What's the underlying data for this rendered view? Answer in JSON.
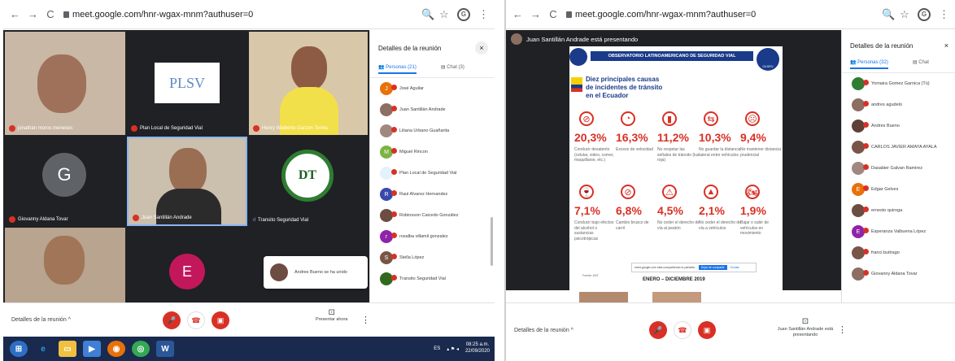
{
  "left": {
    "url": "meet.google.com/hnr-wgax-mnm?authuser=0",
    "panel_title": "Detalles de la reunión",
    "tab_people": "Personas (21)",
    "tab_chat": "Chat (3)",
    "participants": [
      {
        "initial": "J",
        "name": "José Aguilar",
        "color": "#e8710a"
      },
      {
        "initial": "",
        "name": "Juan Santillán Andrade",
        "color": "#8d6e63"
      },
      {
        "initial": "",
        "name": "Liliana Urbano Guañarita",
        "color": "#a1887f"
      },
      {
        "initial": "M",
        "name": "Miguel Rincon",
        "color": "#7cb342"
      },
      {
        "initial": "",
        "name": "Plan Local de Seguridad Vial",
        "color": "#e3f2fd"
      },
      {
        "initial": "R",
        "name": "Raul Alvarez Hernandez",
        "color": "#3949ab"
      },
      {
        "initial": "",
        "name": "Robinsson Caicedo González",
        "color": "#6d4c41"
      },
      {
        "initial": "r",
        "name": "rosalba villamil gonzalez",
        "color": "#8e24aa"
      },
      {
        "initial": "S",
        "name": "Stella López",
        "color": "#795548"
      },
      {
        "initial": "",
        "name": "Transito Seguridad Vial",
        "color": "#33691e"
      }
    ],
    "tiles": [
      {
        "name": "jonathan moros meneses"
      },
      {
        "name": "Plan Local de Seguridad Vial",
        "logo": "PLSV"
      },
      {
        "name": "Henry Walberto Garzon Torres"
      },
      {
        "name": "Giovanny Aldana Tovar",
        "initial": "G"
      },
      {
        "name": "Juan Santillán Andrade"
      },
      {
        "name": "Transito Seguridad Vial",
        "logo": "DT"
      },
      {
        "initial": "E"
      }
    ],
    "toast": "Andres Bueno se ha unido",
    "meeting_details": "Detalles de la reunión",
    "present_now": "Presentar ahora",
    "time": "08:25 a.m.",
    "date": "22/09/2020",
    "lang": "ES"
  },
  "right": {
    "url": "meet.google.com/hnr-wgax-mnm?authuser=0",
    "presenting": "Juan Santillán Andrade está presentando",
    "panel_title": "Detalles de la reunión",
    "tab_people": "Personas (32)",
    "tab_chat": "Chat",
    "participants": [
      {
        "name": "Yomaira Gomez Garnica (Tú)",
        "color": "#2e7d32"
      },
      {
        "name": "andres agudelo",
        "color": "#8d6e63"
      },
      {
        "name": "Andres Bueno",
        "color": "#5d4037"
      },
      {
        "name": "CARLOS JAVIER AMAYA AYALA",
        "color": "#795548"
      },
      {
        "name": "Dasabier Galvan Ramirez",
        "color": "#a1887f"
      },
      {
        "name": "Edgar Gelves",
        "color": "#e8710a",
        "initial": "E"
      },
      {
        "name": "ernesto quiroga",
        "color": "#6d4c41"
      },
      {
        "name": "Esperanza Valbuena López",
        "color": "#8e24aa",
        "initial": "E"
      },
      {
        "name": "franci.buitrago",
        "color": "#795548"
      },
      {
        "name": "Giovanny Aldana Tovar",
        "color": "#8d6e63"
      }
    ],
    "slide": {
      "org": "OBSERVATORIO LATINOAMERICANO DE SEGURIDAD VIAL",
      "logo": "OLSEV",
      "title": "Diez principales causas de incidentes de tránsito en el Ecuador",
      "row1": [
        {
          "pct": "20,3%",
          "desc": "Conducir desatento (celular, video, comer, maquillarse, etc.)",
          "icon": "⊘"
        },
        {
          "pct": "16,3%",
          "desc": "Exceso de velocidad",
          "icon": "◔"
        },
        {
          "pct": "11,2%",
          "desc": "No respetar las señales de tránsito (luz roja)",
          "icon": "▮"
        },
        {
          "pct": "10,3%",
          "desc": "No guardar la distancia lateral entre vehículos",
          "icon": "⇆"
        },
        {
          "pct": "9,4%",
          "desc": "No mantener distancia prudencial",
          "icon": "☹"
        }
      ],
      "row2": [
        {
          "pct": "7,1%",
          "desc": "Conducir bajo efectos del alcohol o sustancias psicotrópicas",
          "icon": "🍷"
        },
        {
          "pct": "6,8%",
          "desc": "Cambio brusco de carril",
          "icon": "⊘"
        },
        {
          "pct": "4,5%",
          "desc": "No ceder el derecho de vía al peatón",
          "icon": "⚠"
        },
        {
          "pct": "2,1%",
          "desc": "No ceder el derecho de vía a vehículos",
          "icon": "▲"
        },
        {
          "pct": "1,9%",
          "desc": "Bajar o subir de vehículos en movimiento",
          "icon": "🏍"
        }
      ],
      "period": "ENERO – DICIEMBRE 2019",
      "source": "Fuente: ANT",
      "share_bar": "meet.google.com está compartiendo tu pantalla.",
      "stop_share": "Dejar de compartir",
      "hide": "Ocultar"
    },
    "meeting_details": "Detalles de la reunión",
    "presenter_status": "Juan Santillán Andrade está presentando"
  }
}
